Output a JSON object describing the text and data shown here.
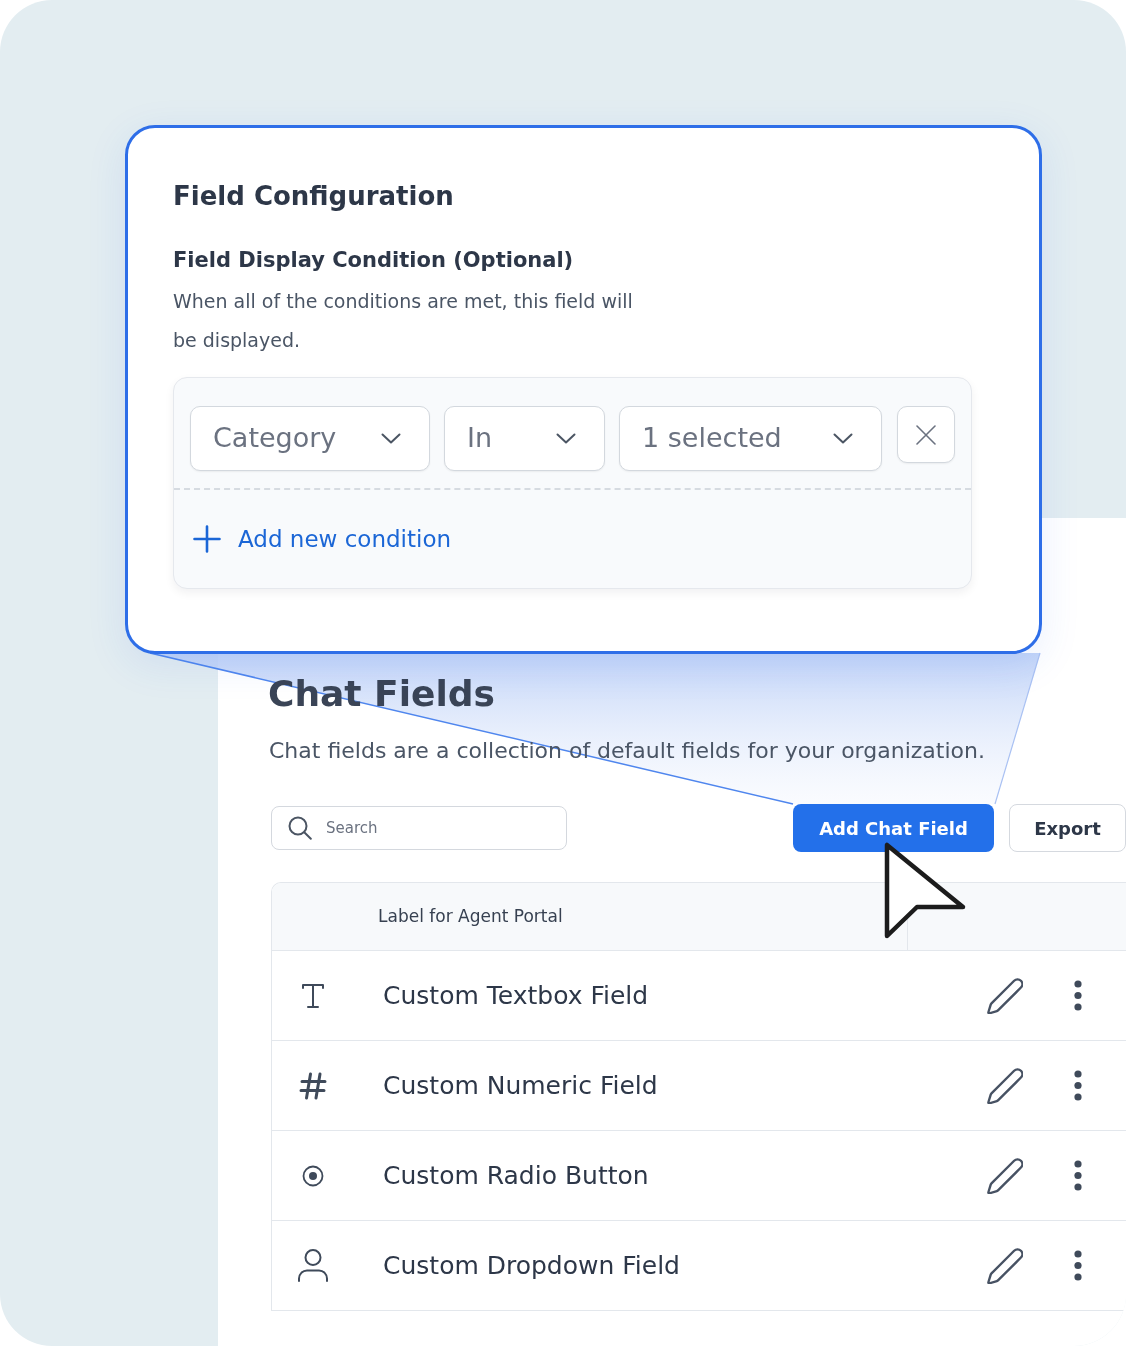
{
  "config_card": {
    "title": "Field Configuration",
    "section_title": "Field Display Condition (Optional)",
    "description": "When all of the conditions are met, this field will be displayed.",
    "conditions": [
      {
        "field": "Category",
        "operator": "In",
        "value": "1 selected"
      }
    ],
    "add_condition": "Add new condition"
  },
  "page": {
    "title": "Chat Fields",
    "subtitle": "Chat fields are a collection of default fields for your organization.",
    "search": {
      "placeholder": "Search"
    },
    "buttons": [
      {
        "label": "Add Chat Field",
        "kind": "primary"
      },
      {
        "label": "Export",
        "kind": "secondary"
      }
    ]
  },
  "table": {
    "columns": [
      "Label for Agent Portal"
    ],
    "rows": [
      {
        "kind": "textbox",
        "label": "Custom Textbox Field"
      },
      {
        "kind": "numeric",
        "label": "Custom Numeric Field"
      },
      {
        "kind": "radio",
        "label": "Custom Radio Button"
      },
      {
        "kind": "dropdown",
        "label": "Custom Dropdown Field"
      }
    ]
  }
}
